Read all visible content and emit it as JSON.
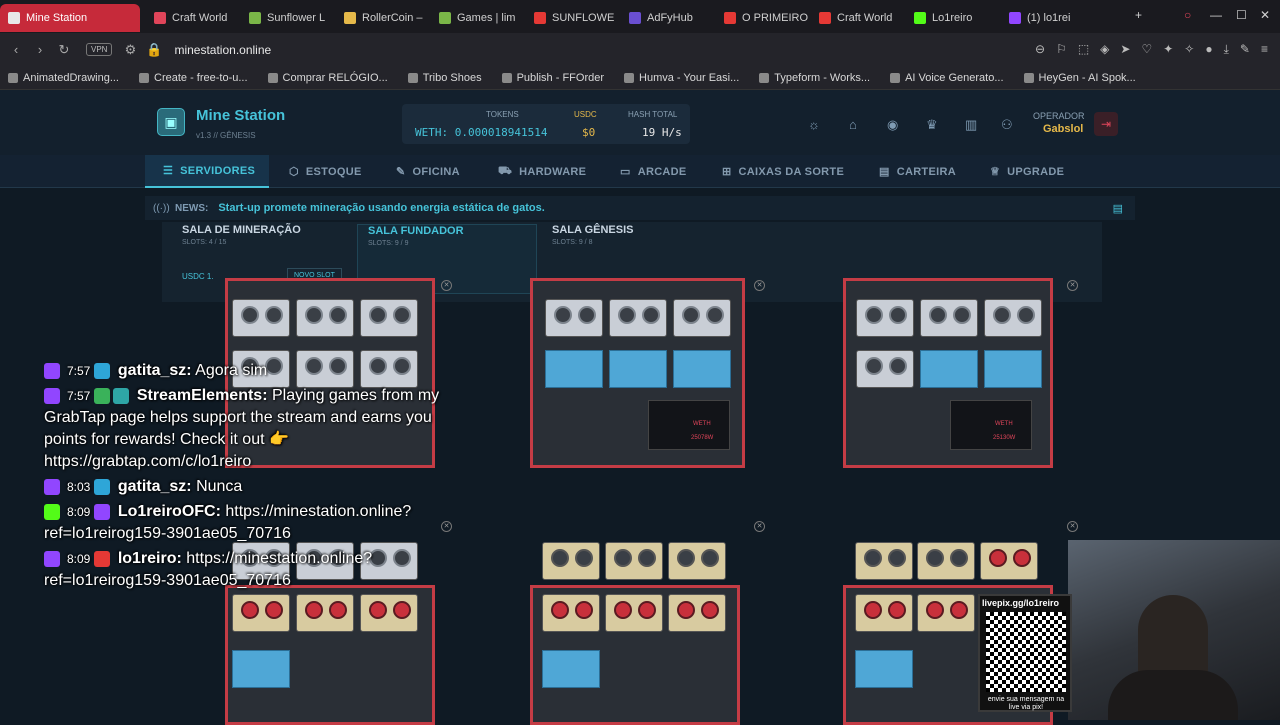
{
  "browser": {
    "tabs": [
      {
        "label": "Mine Station",
        "color": "#e8e8e8",
        "active": true
      },
      {
        "label": "Craft World",
        "color": "#e0455a"
      },
      {
        "label": "Sunflower L",
        "color": "#7ab648"
      },
      {
        "label": "RollerCoin –",
        "color": "#e6b94a"
      },
      {
        "label": "Games | lim",
        "color": "#7ab648"
      },
      {
        "label": "SUNFLOWE",
        "color": "#e53935"
      },
      {
        "label": "AdFyHub",
        "color": "#6a4fd1"
      },
      {
        "label": "O PRIMEIRO",
        "color": "#e53935"
      },
      {
        "label": "Craft World",
        "color": "#e53935"
      },
      {
        "label": "Lo1reiro",
        "color": "#53fc18"
      },
      {
        "label": "(1) lo1rei",
        "color": "#9146ff"
      }
    ],
    "url": "minestation.online",
    "vpn_label": "VPN",
    "bookmarks": [
      "AnimatedDrawing...",
      "Create - free-to-u...",
      "Comprar RELÓGIO...",
      "Tribo Shoes",
      "Publish - FFOrder",
      "Humva - Your Easi...",
      "Typeform - Works...",
      "AI Voice Generato...",
      "HeyGen - AI Spok..."
    ]
  },
  "site": {
    "brand": "Mine Station",
    "version": "v1.3 // GÊNESIS",
    "stats": {
      "tokens_label": "TOKENS",
      "tokens_value": "WETH: 0.000018941514",
      "usdc_label": "USDC",
      "usdc_value": "$0",
      "hash_label": "HASH TOTAL",
      "hash_value": "19 H/s"
    },
    "operator_label": "OPERADOR",
    "operator_name": "Gabslol",
    "nav": [
      "SERVIDORES",
      "ESTOQUE",
      "OFICINA",
      "HARDWARE",
      "ARCADE",
      "CAIXAS DA SORTE",
      "CARTEIRA",
      "UPGRADE"
    ],
    "news_label": "NEWS:",
    "news_text": "Start-up promete mineração usando energia estática de gatos.",
    "rooms": [
      {
        "title": "SALA DE MINERAÇÃO",
        "slots": "SLOTS: 4 / 15"
      },
      {
        "title": "SALA FUNDADOR",
        "slots": "SLOTS: 9 / 9"
      },
      {
        "title": "SALA GÊNESIS",
        "slots": "SLOTS: 9 / 8"
      }
    ],
    "room_usdc": "USDC 1.",
    "room_button": "NOVO SLOT",
    "panel_token": "WETH",
    "panel_values": [
      "25078W",
      "25130W"
    ]
  },
  "chat": [
    {
      "time": "7:57",
      "user": "gatita_sz:",
      "text": "Agora sim",
      "color": "#9146ff"
    },
    {
      "time": "7:57",
      "user": "StreamElements:",
      "text": "Playing games from my GrabTap page helps support the stream and earns you points for rewards! Check it out 👉 https://grabtap.com/c/lo1reiro",
      "color": "#9146ff"
    },
    {
      "time": "8:03",
      "user": "gatita_sz:",
      "text": "Nunca",
      "color": "#9146ff"
    },
    {
      "time": "8:09",
      "user": "Lo1reiroOFC:",
      "text": "https://minestation.online?ref=lo1reirog159-3901ae05_70716",
      "color": "#53fc18"
    },
    {
      "time": "8:09",
      "user": "lo1reiro:",
      "text": "https://minestation.online?ref=lo1reirog159-3901ae05_70716",
      "color": "#9146ff"
    }
  ],
  "overlay": {
    "qr_label": "livepix.gg/lo1reiro",
    "qr_footer": "envie sua mensagem na live via pix!"
  }
}
